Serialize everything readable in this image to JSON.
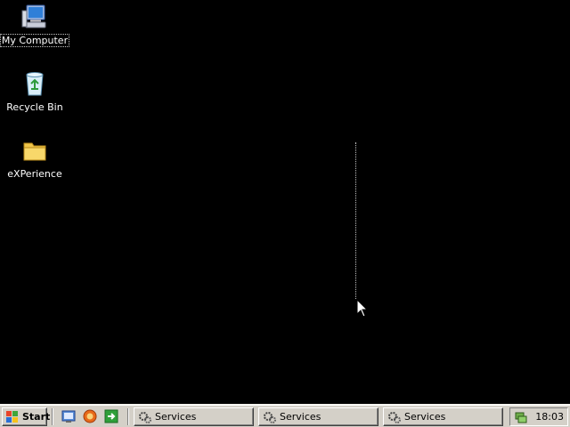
{
  "desktop": {
    "background_color": "#000000",
    "icons": [
      {
        "label": "My Computer",
        "icon": "computer-icon",
        "selected": true
      },
      {
        "label": "Recycle Bin",
        "icon": "recycle-bin-icon",
        "selected": false
      },
      {
        "label": "eXPerience",
        "icon": "folder-icon",
        "selected": false
      }
    ]
  },
  "taskbar": {
    "start_label": "Start",
    "quick_launch": [
      {
        "icon": "show-desktop-icon"
      },
      {
        "icon": "browser-icon"
      },
      {
        "icon": "run-arrow-icon"
      }
    ],
    "tasks": [
      {
        "label": "Services",
        "icon": "services-gear-icon"
      },
      {
        "label": "Services",
        "icon": "services-gear-icon"
      },
      {
        "label": "Services",
        "icon": "services-gear-icon"
      }
    ],
    "tray": {
      "clock": "18:03",
      "icon": "network-tray-icon"
    }
  }
}
